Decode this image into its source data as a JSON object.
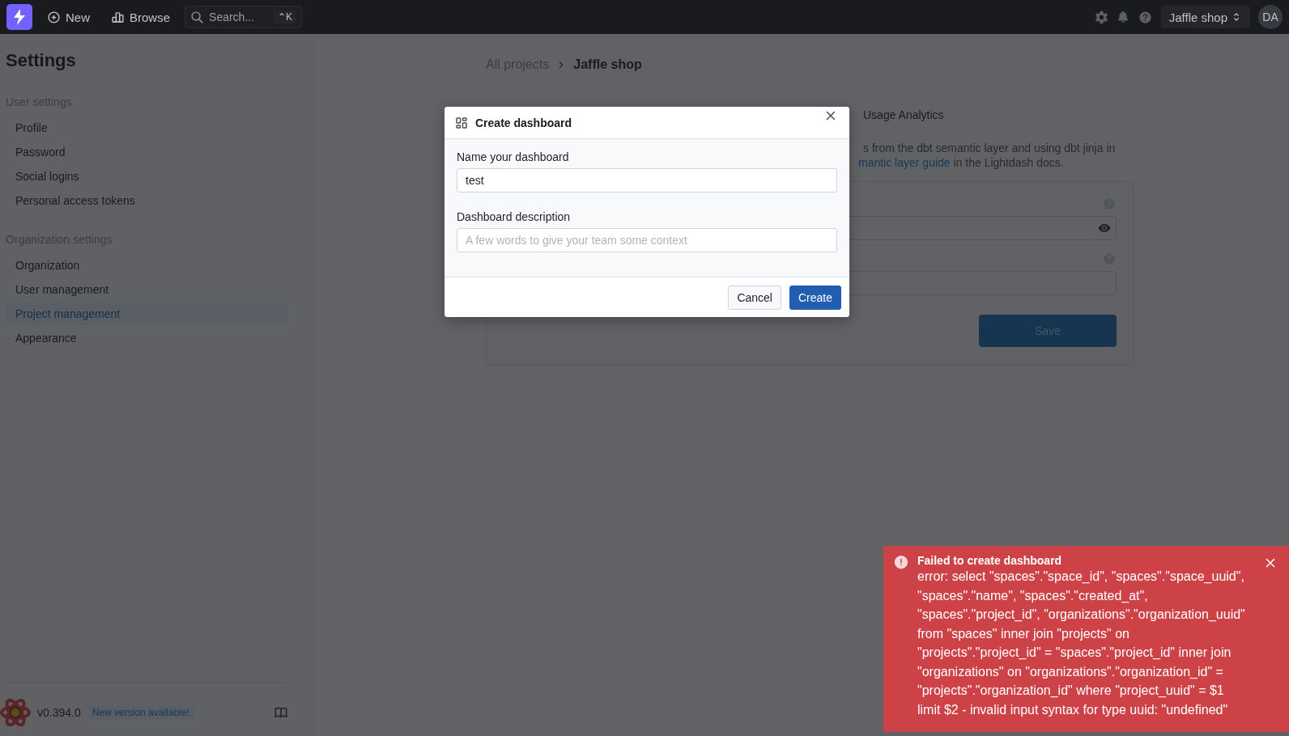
{
  "topbar": {
    "new_label": "New",
    "browse_label": "Browse",
    "search": {
      "placeholder": "Search...",
      "shortcut": "⌃K"
    },
    "project": "Jaffle shop",
    "avatar": "DA"
  },
  "sidebar": {
    "title": "Settings",
    "sections": [
      {
        "title": "User settings",
        "items": [
          {
            "label": "Profile",
            "selected": false
          },
          {
            "label": "Password",
            "selected": false
          },
          {
            "label": "Social logins",
            "selected": false
          },
          {
            "label": "Personal access tokens",
            "selected": false
          }
        ]
      },
      {
        "title": "Organization settings",
        "items": [
          {
            "label": "Organization",
            "selected": false
          },
          {
            "label": "User management",
            "selected": false
          },
          {
            "label": "Project management",
            "selected": true
          },
          {
            "label": "Appearance",
            "selected": false
          }
        ]
      }
    ],
    "version": "v0.394.0",
    "update_badge": "New version available!"
  },
  "main": {
    "breadcrumb": [
      {
        "label": "All projects",
        "current": false
      },
      {
        "label": "Jaffle shop",
        "current": true
      }
    ],
    "tab": "Usage Analytics",
    "description_lines": [
      {
        "parts": [
          {
            "text": "s from the dbt semantic layer and using dbt jinja in",
            "link": false
          }
        ]
      },
      {
        "parts": [
          {
            "text": "mantic layer guide",
            "link": true
          },
          {
            "text": " in the Lightdash docs.",
            "link": false
          }
        ]
      }
    ],
    "fields": [
      {
        "kind": "secret"
      },
      {
        "kind": "text"
      }
    ],
    "save_label": "Save"
  },
  "modal": {
    "title": "Create dashboard",
    "name_label": "Name your dashboard",
    "name_value": "test",
    "description_label": "Dashboard description",
    "description_placeholder": "A few words to give your team some context",
    "cancel_label": "Cancel",
    "create_label": "Create"
  },
  "toast": {
    "title": "Failed to create dashboard",
    "message": "error: select \"spaces\".\"space_id\", \"spaces\".\"space_uuid\", \"spaces\".\"name\", \"spaces\".\"created_at\", \"spaces\".\"project_id\", \"organizations\".\"organization_uuid\" from \"spaces\" inner join \"projects\" on \"projects\".\"project_id\" = \"spaces\".\"project_id\" inner join \"organizations\" on \"organizations\".\"organization_id\" = \"projects\".\"organization_id\" where \"project_uuid\" = $1 limit $2 - invalid input syntax for type uuid: \"undefined\""
  }
}
